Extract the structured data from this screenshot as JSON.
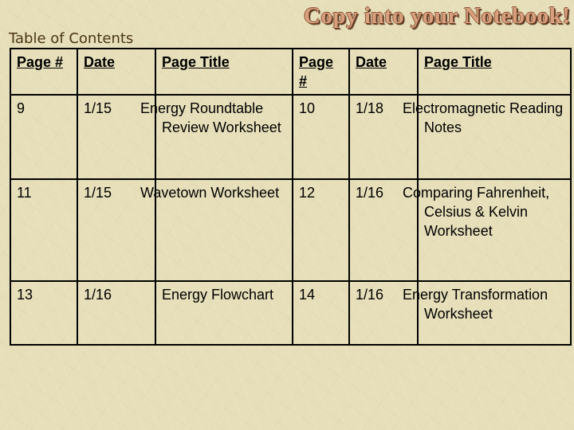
{
  "slide": {
    "title": "Copy into your Notebook!",
    "subtitle": "Table of Contents"
  },
  "table": {
    "headers": [
      "Page #",
      "Date",
      "Page Title",
      "Page #",
      "Date",
      "Page Title"
    ],
    "rows": [
      [
        "9",
        "1/15",
        "Energy Roundtable Review Worksheet",
        "10",
        "1/18",
        "Electromagnetic Reading Notes"
      ],
      [
        "11",
        "1/15",
        "Wavetown Worksheet",
        "12",
        "1/16",
        "Comparing Fahrenheit, Celsius & Kelvin Worksheet"
      ],
      [
        "13",
        "1/16",
        "Energy Flowchart",
        "14",
        "1/16",
        "Energy Transformation Worksheet"
      ]
    ]
  }
}
